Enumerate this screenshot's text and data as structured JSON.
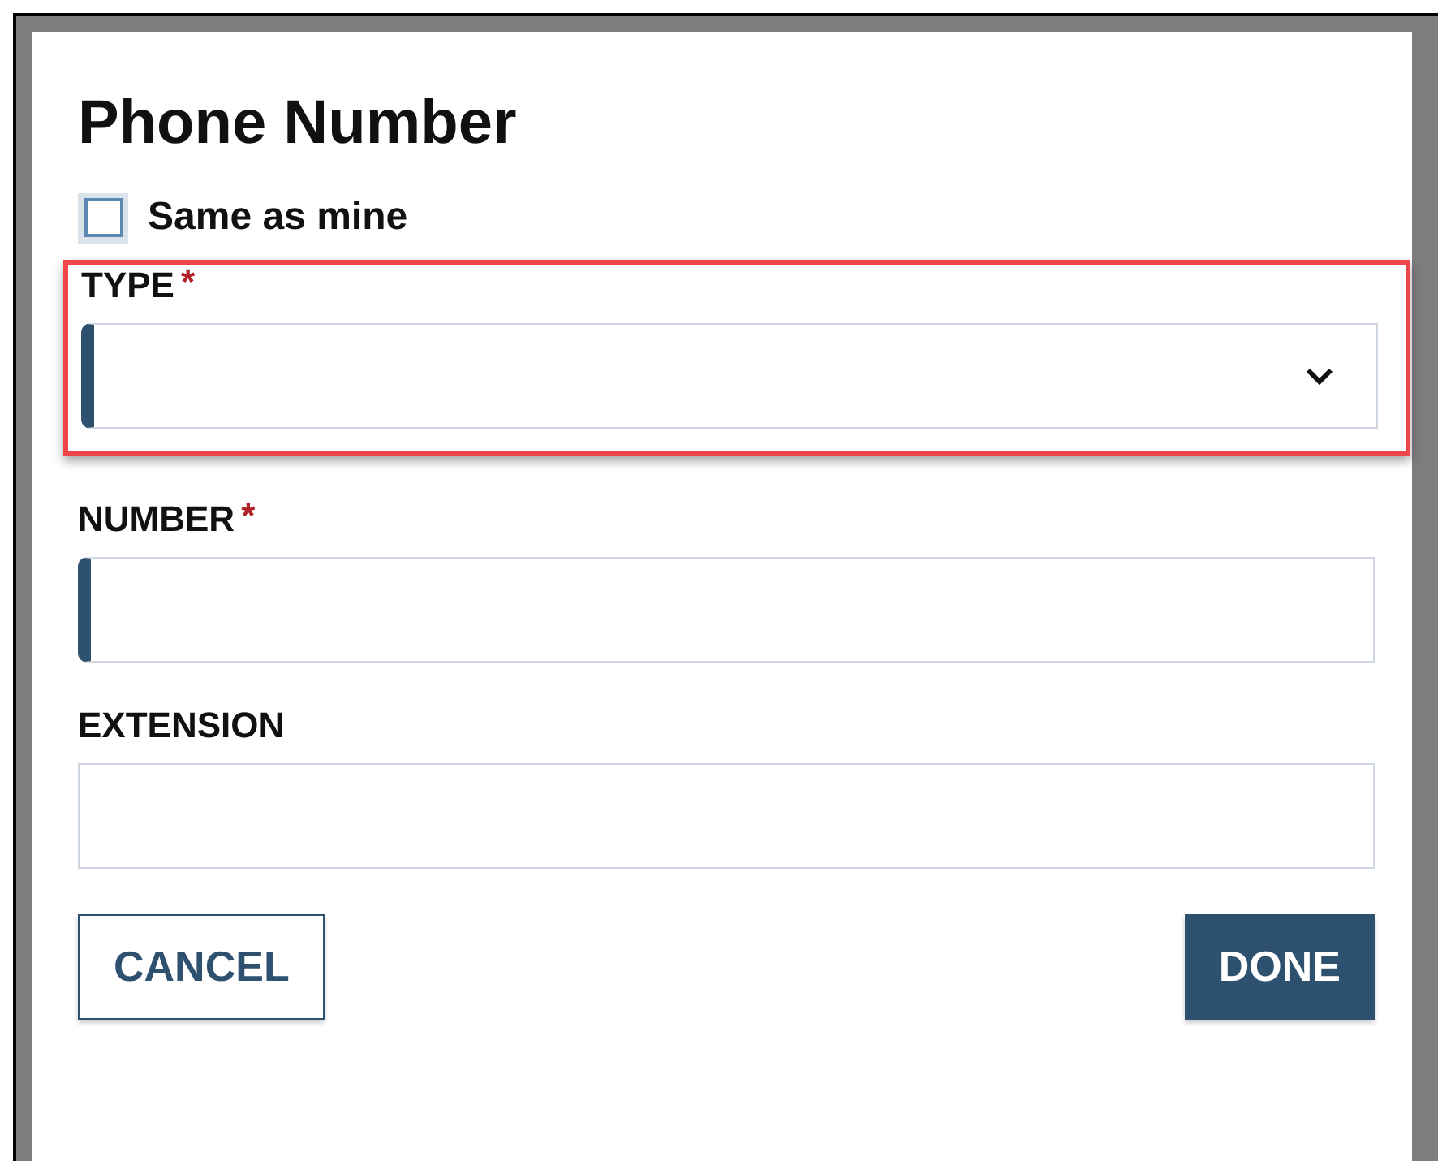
{
  "dialog": {
    "title": "Phone Number"
  },
  "same_as_mine": {
    "label": "Same as mine",
    "checked": false
  },
  "fields": [
    {
      "kind": "select",
      "label": "TYPE",
      "required": true,
      "highlighted": true
    },
    {
      "kind": "text",
      "label": "NUMBER",
      "required": true,
      "highlighted": false
    },
    {
      "kind": "text",
      "label": "EXTENSION",
      "required": false,
      "highlighted": false
    }
  ],
  "required_mark": "*",
  "buttons": [
    {
      "kind": "secondary",
      "label": "CANCEL"
    },
    {
      "kind": "primary",
      "label": "DONE"
    }
  ]
}
